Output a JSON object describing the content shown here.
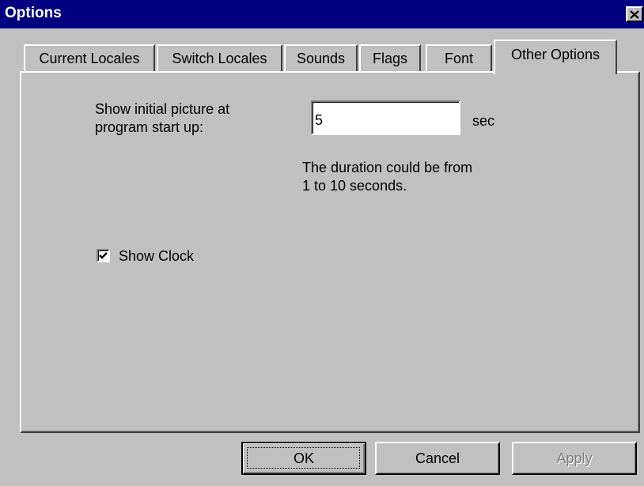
{
  "window": {
    "title": "Options",
    "close_icon": "close-x-icon"
  },
  "tabs": [
    {
      "label": "Current Locales",
      "active": false
    },
    {
      "label": "Switch Locales",
      "active": false
    },
    {
      "label": "Sounds",
      "active": false
    },
    {
      "label": "Flags",
      "active": false
    },
    {
      "label": "Font",
      "active": false
    },
    {
      "label": "Other Options",
      "active": true
    }
  ],
  "other_options": {
    "picture_label_line1": "Show initial picture at",
    "picture_label_line2": "program start up:",
    "duration_value": "5",
    "duration_unit": "sec",
    "hint_line1": "The duration could be from",
    "hint_line2": "1 to 10 seconds.",
    "show_clock_label": "Show Clock",
    "show_clock_checked": true,
    "checkmark_icon": "checkmark-icon"
  },
  "buttons": {
    "ok_label": "OK",
    "cancel_label": "Cancel",
    "apply_label": "Apply",
    "apply_enabled": false
  },
  "colors": {
    "titlebar": "#000080",
    "face": "#c0c0c0",
    "disabled_text": "#808080"
  }
}
